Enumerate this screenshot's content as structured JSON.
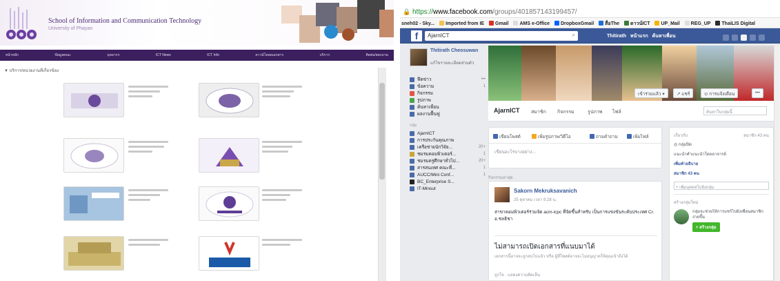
{
  "left": {
    "site_title": "School of Information and Communication Technology",
    "subtitle": "University of Phayao",
    "nav": [
      "หน้าหลัก",
      "ข้อมูลคณะ",
      "บุคลากร",
      "ICT News",
      "ICT Info",
      "ดาวน์โหลดเอกสาร",
      "บริการ",
      "ติดต่อ/สอบถาม"
    ],
    "breadcrumb": "▼ บริการ/หน่วยงานที่เกี่ยวข้อง",
    "colors": {
      "nav_bg": "#3c1f5e",
      "brand": "#4b2a76"
    }
  },
  "right": {
    "url": {
      "scheme": "https://",
      "host": "www.facebook.com",
      "path": "/groups/401857143199457/"
    },
    "bookmarks": [
      "sneh02 - Sky...",
      "Imported from IE",
      "Gmail",
      "AMS e-Office",
      "DropboxGmail",
      "สื่อThe",
      "ดาวน์ICT",
      "UP_Mail",
      "REG_UP",
      "ThaiLIS Digital"
    ],
    "fb_search": "AjarnICT",
    "fb_user": "Thitirath",
    "fb_top_links": [
      "หน้าแรก",
      "ค้นหาเพื่อน"
    ],
    "profile": {
      "name": "Thitirath Cheosuwan",
      "sub": "แก้ไขรายละเอียดส่วนตัว"
    },
    "side_items": [
      {
        "label": "ฟีดข่าว",
        "count": "•••"
      },
      {
        "label": "ข้อความ",
        "count": "1"
      },
      {
        "label": "กิจกรรม",
        "count": ""
      },
      {
        "label": "รูปภาพ",
        "count": ""
      },
      {
        "label": "ค้นหาเพื่อน",
        "count": ""
      },
      {
        "label": "ผลงานฟื้นฟู",
        "count": ""
      }
    ],
    "side_groups_header": "กลุ่ม",
    "side_groups": [
      {
        "label": "AjarnICT",
        "count": ""
      },
      {
        "label": "การประกันคุณภาพ",
        "count": ""
      },
      {
        "label": "เครือข่ายนักวิจัย...",
        "count": "20+"
      },
      {
        "label": "ชมรมคอมพิวเตอร์...",
        "count": "1"
      },
      {
        "label": "ชมรมครูศึกษาทั่วไป...",
        "count": "20+"
      },
      {
        "label": "สารสนเทศ คณะที่...",
        "count": "1"
      },
      {
        "label": "AUCC/Mini Conf...",
        "count": "1"
      },
      {
        "label": "BC_Enterprise S...",
        "count": ""
      },
      {
        "label": "IT-Minsut",
        "count": ""
      }
    ],
    "cover_buttons": [
      "เข้าร่วมแล้ว ▾",
      "↗ แชร์",
      "⊙ การแจ้งเตือน",
      "•••"
    ],
    "group_name": "AjarnICT",
    "tabs": [
      "สมาชิก",
      "กิจกรรม",
      "รูปภาพ",
      "ไฟล์"
    ],
    "group_search_ph": "ค้นหาในกลุ่มนี้",
    "compose_buttons": [
      "เขียนโพสต์",
      "เพิ่มรูปภาพ/วิดีโอ",
      "ถามคำถาม",
      "เพิ่มไฟล์"
    ],
    "compose_placeholder": "เขียนอะไรบางอย่าง...",
    "recent": "กิจกรรมล่าสุด",
    "post": {
      "author": "Sakorn Mekruksavanich",
      "time": "25 ตุลาคม เวลา 9:28 น.",
      "text": "สาขาคอมพิวเตอร์ร่วมจัด acm-icpc ที่จัดขึ้นสำหรับ เป็นการแข่งขันระดับประเทศ Cr. อ.ชลธิชา",
      "doc_title": "ไม่สามารถเปิดเอกสารที่แนบมาได้",
      "doc_desc": "เอกสารนี้อาจจะถูกลบไปแล้ว หรือ ผู้ที่โพสต์อาจจะไม่อนุญาตให้คุณเข้าถึงได้",
      "footer": "ถูกใจ · แสดงความคิดเห็น"
    },
    "right_col": {
      "about_h": "เกี่ยวกับ",
      "members": "สมาชิก 43 คน",
      "privacy": "กลุ่มปิด",
      "desc": "แนะนำคำแนะนำโดยอาจารย์",
      "desc_link": "เพิ่มคำอธิบาย",
      "add_member": "สมาชิก 43 คน",
      "invite_ph": "+ เพิ่มบุคคลไปยังกลุ่ม",
      "suggest_h": "สร้างกลุ่มใหม่",
      "suggest_text": "กลุ่มจะช่วยให้การแชร์ไปยังเพื่อนสมาชิกง่ายขึ้น",
      "create_btn": "+ สร้างกลุ่ม"
    },
    "colors": {
      "fb_blue": "#3b5998",
      "fb_bg": "#e9ebee",
      "green": "#42b72a"
    }
  }
}
